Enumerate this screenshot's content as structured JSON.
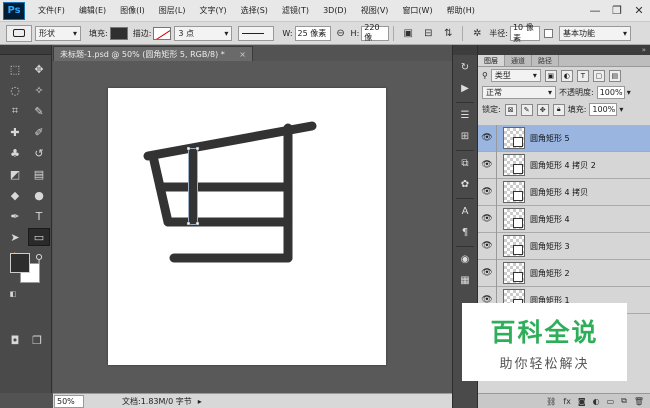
{
  "app": {
    "logo": "Ps"
  },
  "menu": [
    "文件(F)",
    "编辑(E)",
    "图像(I)",
    "图层(L)",
    "文字(Y)",
    "选择(S)",
    "滤镜(T)",
    "3D(D)",
    "视图(V)",
    "窗口(W)",
    "帮助(H)"
  ],
  "window_controls": {
    "minimize": "—",
    "restore": "❐",
    "close": "✕"
  },
  "options": {
    "mode": "形状",
    "fill_label": "填充:",
    "stroke_label": "描边:",
    "stroke_width": "3 点",
    "w_label": "W:",
    "w_value": "25 像素",
    "link_icon": "⊖",
    "h_label": "H:",
    "h_value": "220 像",
    "radius_label": "半径:",
    "radius_value": "10 像素",
    "workspace": "基本功能",
    "colors": {
      "fill": "#2f2f2f",
      "stroke": "none"
    }
  },
  "document": {
    "tab_title": "未标题-1.psd @ 50% (圆角矩形 5, RGB/8) *",
    "tab_close": "×",
    "zoom": "50%",
    "doc_info": "文档:1.83M/0 字节",
    "shape_color": "#333333"
  },
  "layers_panel": {
    "tabs": [
      "图层",
      "通道",
      "路径"
    ],
    "filter_kind": "类型",
    "blend_mode": "正常",
    "opacity_label": "不透明度:",
    "opacity_value": "100%",
    "lock_label": "锁定:",
    "fill_label": "填充:",
    "fill_value": "100%",
    "layers": [
      {
        "name": "圆角矩形 5",
        "selected": true
      },
      {
        "name": "圆角矩形 4 拷贝 2",
        "selected": false
      },
      {
        "name": "圆角矩形 4 拷贝",
        "selected": false
      },
      {
        "name": "圆角矩形 4",
        "selected": false
      },
      {
        "name": "圆角矩形 3",
        "selected": false
      },
      {
        "name": "圆角矩形 2",
        "selected": false
      },
      {
        "name": "圆角矩形 1",
        "selected": false
      }
    ]
  },
  "watermark": {
    "title": "百科全说",
    "subtitle": "助你轻松解决"
  }
}
